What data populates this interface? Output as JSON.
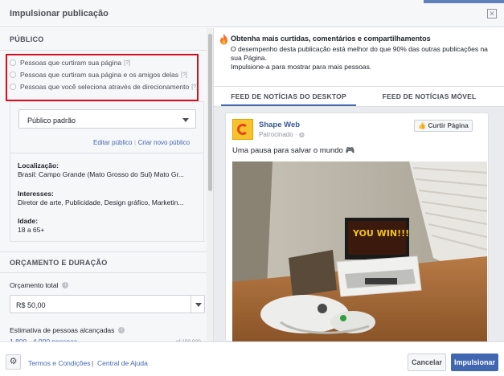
{
  "dialog": {
    "title": "Impulsionar publicação",
    "close_glyph": "✕",
    "colors": {
      "accent": "#4267b2",
      "highlight": "#d40f1e",
      "panel": "#f6f7f9"
    }
  },
  "audience": {
    "section_title": "PÚBLICO",
    "help_mark": "[?]",
    "options": [
      {
        "label": "Pessoas que curtiram sua página",
        "selected": false
      },
      {
        "label": "Pessoas que curtiram sua página e os amigos delas",
        "selected": false
      },
      {
        "label": "Pessoas que você seleciona através de direcionamento",
        "selected": false
      }
    ],
    "dropdown_value": "Público padrão",
    "edit_link": "Editar público",
    "create_link": "Criar novo público",
    "location_label": "Localização:",
    "location_value": "Brasil: Campo Grande (Mato Grosso do Sul) Mato Gr...",
    "interests_label": "Interesses:",
    "interests_value": "Diretor de arte, Publicidade, Design gráfico, Marketin...",
    "age_label": "Idade:",
    "age_value": "18 a 65+"
  },
  "budget": {
    "section_title": "ORÇAMENTO E DURAÇÃO",
    "total_label": "Orçamento total",
    "total_value": "R$ 50,00",
    "reach_label": "Estimativa de pessoas alcançadas",
    "reach_value": "1.800 - 4.900 pessoas",
    "reach_of": "of 150.000"
  },
  "tip": {
    "headline": "Obtenha mais curtidas, comentários e compartilhamentos",
    "body_line1": "O desempenho desta publicação está melhor do que 90% das outras publicações na sua Página.",
    "body_line2": "Impulsione-a para mostrar para mais pessoas."
  },
  "tabs": [
    {
      "label": "FEED DE NOTÍCIAS DO DESKTOP",
      "active": true
    },
    {
      "label": "FEED DE NOTÍCIAS MÓVEL",
      "active": false
    }
  ],
  "preview": {
    "page_name": "Shape Web",
    "sponsored": "Patrocinado · ",
    "like_button": "Curtir Página",
    "post_text": "Uma pausa para salvar o mundo 🎮",
    "image_caption": "YOU WIN!!!"
  },
  "footer": {
    "gear_glyph": "⚙",
    "terms_link": "Termos e Condições",
    "separator": "|",
    "help_link": "Central de Ajuda",
    "cancel_button": "Cancelar",
    "boost_button": "Impulsionar"
  }
}
